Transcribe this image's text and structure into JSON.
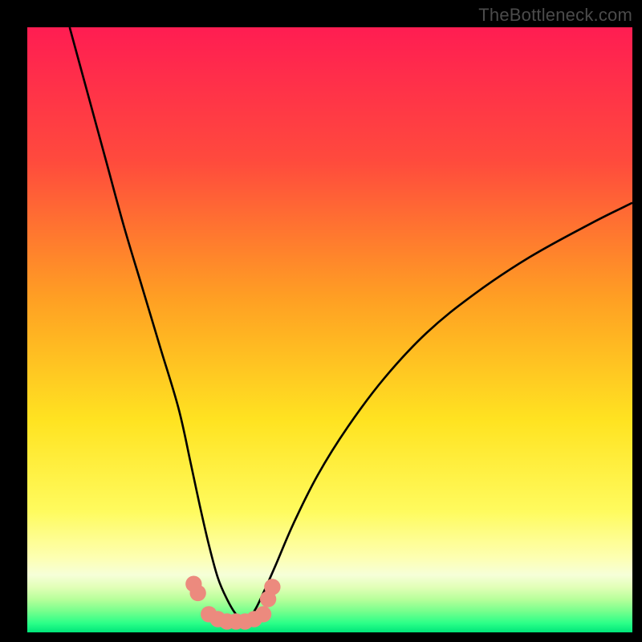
{
  "watermark": "TheBottleneck.com",
  "chart_data": {
    "type": "line",
    "title": "",
    "xlabel": "",
    "ylabel": "",
    "xlim": [
      0,
      100
    ],
    "ylim": [
      0,
      100
    ],
    "series": [
      {
        "name": "left-curve",
        "x": [
          7,
          10,
          13,
          16,
          19,
          22,
          25,
          27,
          28.5,
          30,
          31.5,
          33,
          34.5,
          36
        ],
        "values": [
          100,
          89,
          78,
          67,
          57,
          47,
          37,
          28,
          21,
          14.5,
          9,
          5.5,
          3,
          2
        ]
      },
      {
        "name": "right-curve",
        "x": [
          36,
          37.5,
          39,
          41,
          44,
          48,
          53,
          59,
          66,
          74,
          83,
          93,
          100
        ],
        "values": [
          2,
          3.5,
          6.5,
          11,
          18,
          26,
          34,
          42,
          49.5,
          56,
          62,
          67.5,
          71
        ]
      },
      {
        "name": "salmon-dots",
        "x": [
          27.5,
          28.2,
          30,
          31.5,
          33,
          34.5,
          36,
          37.5,
          39,
          39.8,
          40.5
        ],
        "values": [
          8,
          6.5,
          3,
          2.2,
          1.8,
          1.8,
          1.8,
          2.2,
          3,
          5.5,
          7.5
        ]
      }
    ],
    "gradient_stops": [
      {
        "offset": 0,
        "color": "#ff1d52"
      },
      {
        "offset": 0.22,
        "color": "#ff4a3d"
      },
      {
        "offset": 0.45,
        "color": "#ffa023"
      },
      {
        "offset": 0.65,
        "color": "#ffe321"
      },
      {
        "offset": 0.8,
        "color": "#fffb5e"
      },
      {
        "offset": 0.875,
        "color": "#fdffb0"
      },
      {
        "offset": 0.905,
        "color": "#f6ffd8"
      },
      {
        "offset": 0.925,
        "color": "#e2ffb8"
      },
      {
        "offset": 0.945,
        "color": "#b8ff9b"
      },
      {
        "offset": 0.965,
        "color": "#77ff8d"
      },
      {
        "offset": 0.985,
        "color": "#2bff88"
      },
      {
        "offset": 1.0,
        "color": "#00e57a"
      }
    ],
    "colors": {
      "curve": "#000000",
      "dots": "#ec8a7e"
    }
  }
}
